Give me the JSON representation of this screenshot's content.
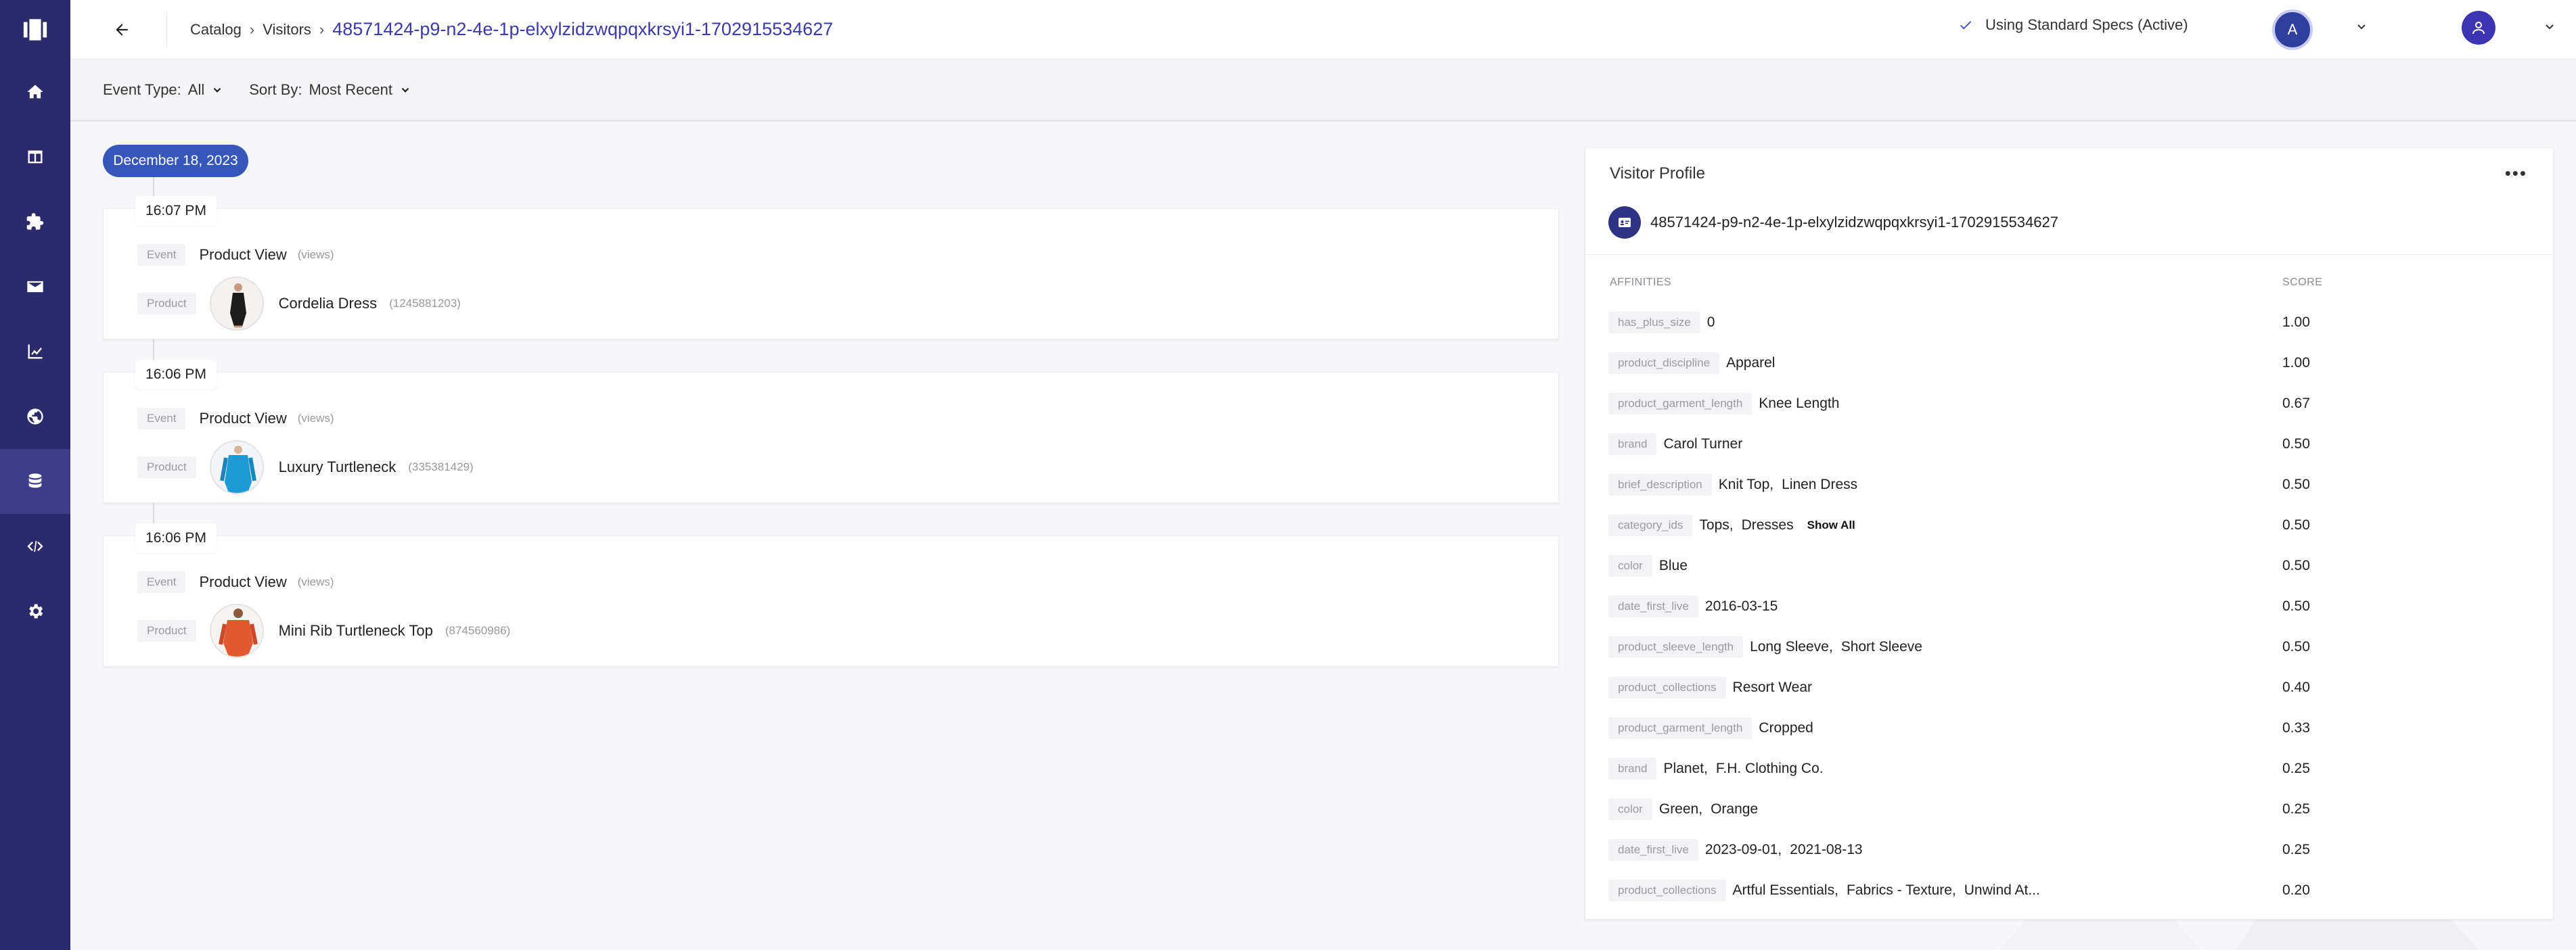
{
  "header": {
    "breadcrumbs": [
      "Catalog",
      "Visitors"
    ],
    "current": "48571424-p9-n2-4e-1p-elxylzidzwqpqxkrsyi1-1702915534627",
    "spec_status": "Using Standard Specs (Active)",
    "avatar_initial": "A"
  },
  "filters": {
    "event_type_label": "Event Type:",
    "event_type_value": "All",
    "sort_by_label": "Sort By:",
    "sort_by_value": "Most Recent"
  },
  "timeline": {
    "date": "December 18, 2023",
    "events": [
      {
        "time": "16:07 PM",
        "event_tag": "Event",
        "event_name": "Product View",
        "event_sub": "(views)",
        "product_tag": "Product",
        "product_name": "Cordelia Dress",
        "product_id": "(1245881203)",
        "thumb_color": "#1b1b1b"
      },
      {
        "time": "16:06 PM",
        "event_tag": "Event",
        "event_name": "Product View",
        "event_sub": "(views)",
        "product_tag": "Product",
        "product_name": "Luxury Turtleneck",
        "product_id": "(335381429)",
        "thumb_color": "#1e9bd6"
      },
      {
        "time": "16:06 PM",
        "event_tag": "Event",
        "event_name": "Product View",
        "event_sub": "(views)",
        "product_tag": "Product",
        "product_name": "Mini Rib Turtleneck Top",
        "product_id": "(874560986)",
        "thumb_color": "#e2582f"
      }
    ]
  },
  "profile": {
    "title": "Visitor Profile",
    "more": "•••",
    "visitor_id": "48571424-p9-n2-4e-1p-elxylzidzwqpqxkrsyi1-1702915534627",
    "col_affinities": "AFFINITIES",
    "col_score": "SCORE",
    "show_all": "Show All",
    "affinities": [
      {
        "key": "has_plus_size",
        "values": [
          "0"
        ],
        "score": "1.00"
      },
      {
        "key": "product_discipline",
        "values": [
          "Apparel"
        ],
        "score": "1.00"
      },
      {
        "key": "product_garment_length",
        "values": [
          "Knee Length"
        ],
        "score": "0.67"
      },
      {
        "key": "brand",
        "values": [
          "Carol Turner"
        ],
        "score": "0.50"
      },
      {
        "key": "brief_description",
        "values": [
          "Knit Top,",
          "Linen Dress"
        ],
        "score": "0.50"
      },
      {
        "key": "category_ids",
        "values": [
          "Tops,",
          "Dresses"
        ],
        "score": "0.50",
        "show_all": true
      },
      {
        "key": "color",
        "values": [
          "Blue"
        ],
        "score": "0.50"
      },
      {
        "key": "date_first_live",
        "values": [
          "2016-03-15"
        ],
        "score": "0.50"
      },
      {
        "key": "product_sleeve_length",
        "values": [
          "Long Sleeve,",
          "Short Sleeve"
        ],
        "score": "0.50"
      },
      {
        "key": "product_collections",
        "values": [
          "Resort Wear"
        ],
        "score": "0.40"
      },
      {
        "key": "product_garment_length",
        "values": [
          "Cropped"
        ],
        "score": "0.33"
      },
      {
        "key": "brand",
        "values": [
          "Planet,",
          "F.H. Clothing Co."
        ],
        "score": "0.25"
      },
      {
        "key": "color",
        "values": [
          "Green,",
          "Orange"
        ],
        "score": "0.25"
      },
      {
        "key": "date_first_live",
        "values": [
          "2023-09-01,",
          "2021-08-13"
        ],
        "score": "0.25"
      },
      {
        "key": "product_collections",
        "values": [
          "Artful Essentials,",
          "Fabrics - Texture,",
          "Unwind At..."
        ],
        "score": "0.20"
      }
    ]
  },
  "colors": {
    "sidebar": "#2b2a6b",
    "accent": "#3c3aa8",
    "date_pill": "#3656b9"
  },
  "icons": {
    "sidebar": [
      "logo-icon",
      "home-icon",
      "layout-icon",
      "puzzle-icon",
      "mail-icon",
      "chart-icon",
      "globe-icon",
      "database-icon",
      "code-icon",
      "gear-icon"
    ]
  }
}
